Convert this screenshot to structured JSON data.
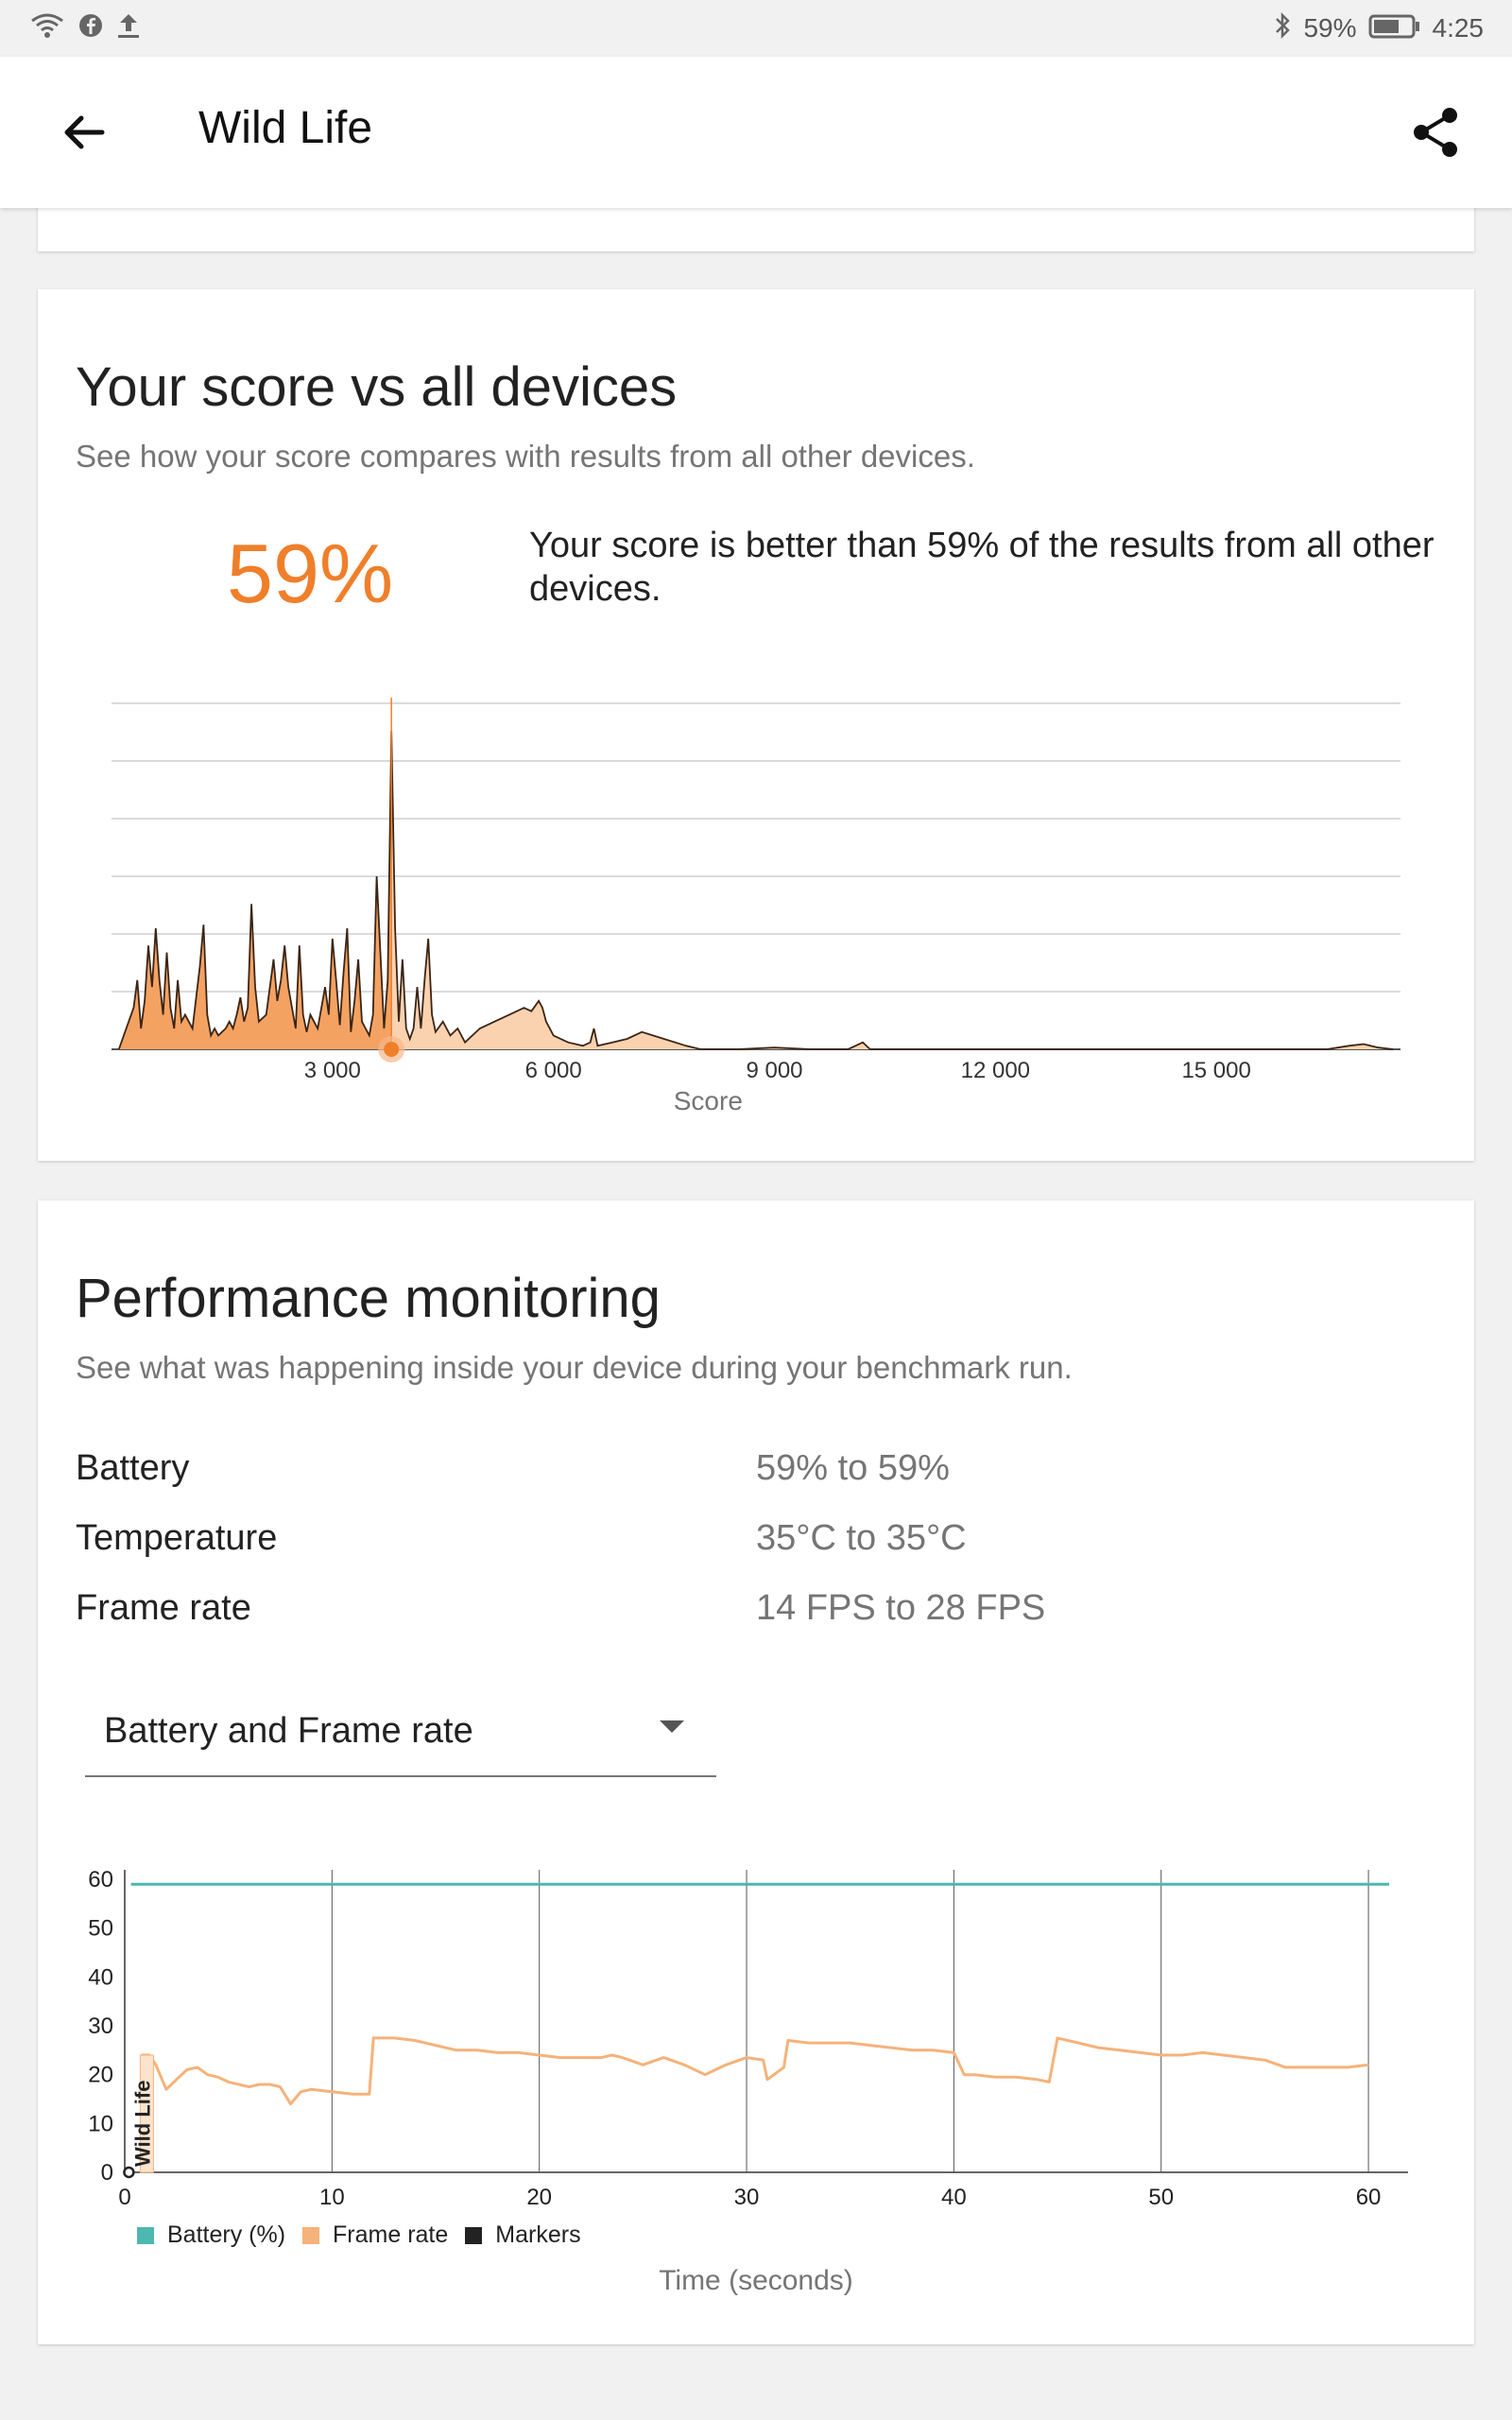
{
  "status_bar": {
    "battery_pct": "59%",
    "time": "4:25",
    "icons": [
      "wifi-icon",
      "facebook-icon",
      "upload-icon",
      "bluetooth-icon",
      "battery-icon"
    ]
  },
  "app_bar": {
    "title": "Wild Life",
    "back_icon": "arrow-left-icon",
    "share_icon": "share-icon"
  },
  "score_card": {
    "title": "Your score vs all devices",
    "subtitle": "See how your score compares with results from all other devices.",
    "percentile": "59%",
    "description": "Your score is better than 59% of the results from all other devices."
  },
  "perf_card": {
    "title": "Performance monitoring",
    "subtitle": "See what was happening inside your device during your benchmark run.",
    "stats": [
      {
        "label": "Battery",
        "value": "59% to 59%"
      },
      {
        "label": "Temperature",
        "value": "35°C to 35°C"
      },
      {
        "label": "Frame rate",
        "value": "14 FPS to 28 FPS"
      }
    ],
    "dropdown_value": "Battery and Frame rate",
    "legend": [
      {
        "label": "Battery (%)",
        "color": "#4cb8b0"
      },
      {
        "label": "Frame rate",
        "color": "#f5b27a"
      },
      {
        "label": "Markers",
        "color": "#222222"
      }
    ],
    "xlabel": "Time (seconds)"
  },
  "chart_data": [
    {
      "type": "area",
      "xlabel": "Score",
      "xticks": [
        3000,
        6000,
        9000,
        12000,
        15000
      ],
      "xtick_labels": [
        "3 000",
        "6 000",
        "9 000",
        "12 000",
        "15 000"
      ],
      "xlim": [
        0,
        17500
      ],
      "ylim": [
        0,
        1
      ],
      "grid": true,
      "your_score": 3800,
      "x": [
        100,
        300,
        350,
        400,
        450,
        500,
        550,
        600,
        650,
        700,
        750,
        800,
        850,
        900,
        950,
        1000,
        1100,
        1150,
        1200,
        1250,
        1300,
        1350,
        1400,
        1450,
        1500,
        1550,
        1600,
        1650,
        1700,
        1750,
        1800,
        1850,
        1900,
        1950,
        2000,
        2100,
        2200,
        2250,
        2300,
        2350,
        2400,
        2450,
        2500,
        2550,
        2600,
        2650,
        2700,
        2800,
        2900,
        2950,
        3000,
        3050,
        3100,
        3150,
        3200,
        3250,
        3300,
        3350,
        3400,
        3450,
        3500,
        3550,
        3600,
        3700,
        3750,
        3800,
        3850,
        3900,
        3950,
        4000,
        4050,
        4100,
        4150,
        4200,
        4250,
        4300,
        4350,
        4400,
        4500,
        4600,
        4700,
        4800,
        5000,
        5200,
        5400,
        5600,
        5700,
        5800,
        5850,
        5900,
        6000,
        6200,
        6400,
        6500,
        6550,
        6600,
        6800,
        7000,
        7200,
        7500,
        7800,
        8000,
        8500,
        9000,
        9500,
        10000,
        10200,
        10300,
        10400,
        10500,
        11000,
        12000,
        13000,
        14000,
        15000,
        16000,
        16500,
        16800,
        17000,
        17200,
        17400
      ],
      "density": [
        0.0,
        0.12,
        0.2,
        0.06,
        0.14,
        0.3,
        0.18,
        0.35,
        0.2,
        0.1,
        0.28,
        0.12,
        0.06,
        0.2,
        0.08,
        0.1,
        0.06,
        0.15,
        0.24,
        0.36,
        0.1,
        0.04,
        0.06,
        0.04,
        0.05,
        0.06,
        0.08,
        0.06,
        0.1,
        0.15,
        0.08,
        0.12,
        0.42,
        0.18,
        0.08,
        0.1,
        0.26,
        0.14,
        0.2,
        0.3,
        0.18,
        0.12,
        0.06,
        0.3,
        0.1,
        0.05,
        0.1,
        0.06,
        0.18,
        0.1,
        0.32,
        0.2,
        0.07,
        0.22,
        0.35,
        0.05,
        0.14,
        0.26,
        0.08,
        0.06,
        0.04,
        0.1,
        0.5,
        0.06,
        0.2,
        0.92,
        0.35,
        0.08,
        0.26,
        0.06,
        0.03,
        0.06,
        0.18,
        0.06,
        0.2,
        0.32,
        0.1,
        0.05,
        0.08,
        0.04,
        0.06,
        0.02,
        0.06,
        0.08,
        0.1,
        0.12,
        0.11,
        0.14,
        0.12,
        0.08,
        0.04,
        0.02,
        0.01,
        0.02,
        0.06,
        0.01,
        0.02,
        0.03,
        0.05,
        0.03,
        0.01,
        0.0,
        0.0,
        0.005,
        0.0,
        0.0,
        0.02,
        0.0,
        0.0,
        0.0,
        0.0,
        0.0,
        0.0,
        0.0,
        0.0,
        0.0,
        0.0,
        0.01,
        0.015,
        0.005,
        0.0
      ]
    },
    {
      "type": "line",
      "xlabel": "Time (seconds)",
      "xlim": [
        0,
        61
      ],
      "ylim": [
        0,
        60
      ],
      "yticks": [
        0,
        10,
        20,
        30,
        40,
        50,
        60
      ],
      "xticks": [
        0,
        10,
        20,
        30,
        40,
        50,
        60
      ],
      "grid": true,
      "series": [
        {
          "name": "Battery (%)",
          "color": "#4cb8b0",
          "x": [
            0.3,
            61
          ],
          "values": [
            59,
            59
          ]
        },
        {
          "name": "Frame rate",
          "color": "#f5b27a",
          "x": [
            0.8,
            1.2,
            1.5,
            2.0,
            2.5,
            3.0,
            3.5,
            4.0,
            4.5,
            5.0,
            5.5,
            6.0,
            6.5,
            7.0,
            7.5,
            8.0,
            8.3,
            8.5,
            9.0,
            10.0,
            11.0,
            11.8,
            12.0,
            13.0,
            14.0,
            15.0,
            16.0,
            17.0,
            18.0,
            19.0,
            20.0,
            21.0,
            22.0,
            23.0,
            23.5,
            24.0,
            25.0,
            26.0,
            27.0,
            28.0,
            29.0,
            30.0,
            30.8,
            31.0,
            31.8,
            32.0,
            33.0,
            35.0,
            36.0,
            37.0,
            38.0,
            39.0,
            40.0,
            40.5,
            41.0,
            42.0,
            43.0,
            44.0,
            44.6,
            45.0,
            46.0,
            47.0,
            48.0,
            49.0,
            50.0,
            51.0,
            52.0,
            53.0,
            54.0,
            55.0,
            56.0,
            57.0,
            58.0,
            59.0,
            60.0
          ],
          "values": [
            24,
            24,
            22,
            17,
            19,
            21,
            21.5,
            20,
            19.5,
            18.5,
            18,
            17.5,
            18,
            18,
            17.5,
            14,
            15.5,
            16.5,
            17,
            16.5,
            16,
            16,
            27.5,
            27.5,
            27,
            26,
            25,
            25,
            24.5,
            24.5,
            24,
            23.5,
            23.5,
            23.5,
            24,
            23.5,
            22,
            23.5,
            22,
            20,
            22,
            23.5,
            23,
            19,
            21.5,
            27,
            26.5,
            26.5,
            26,
            25.5,
            25,
            25,
            24.5,
            20,
            20,
            19.5,
            19.5,
            19,
            18.5,
            27.5,
            26.5,
            25.5,
            25,
            24.5,
            24,
            24,
            24.5,
            24,
            23.5,
            23,
            21.5,
            21.5,
            21.5,
            21.5,
            22
          ]
        },
        {
          "name": "Markers",
          "color": "#222222",
          "x": [
            0.2
          ],
          "values": [
            0
          ],
          "label": "Wild Life"
        }
      ]
    }
  ]
}
